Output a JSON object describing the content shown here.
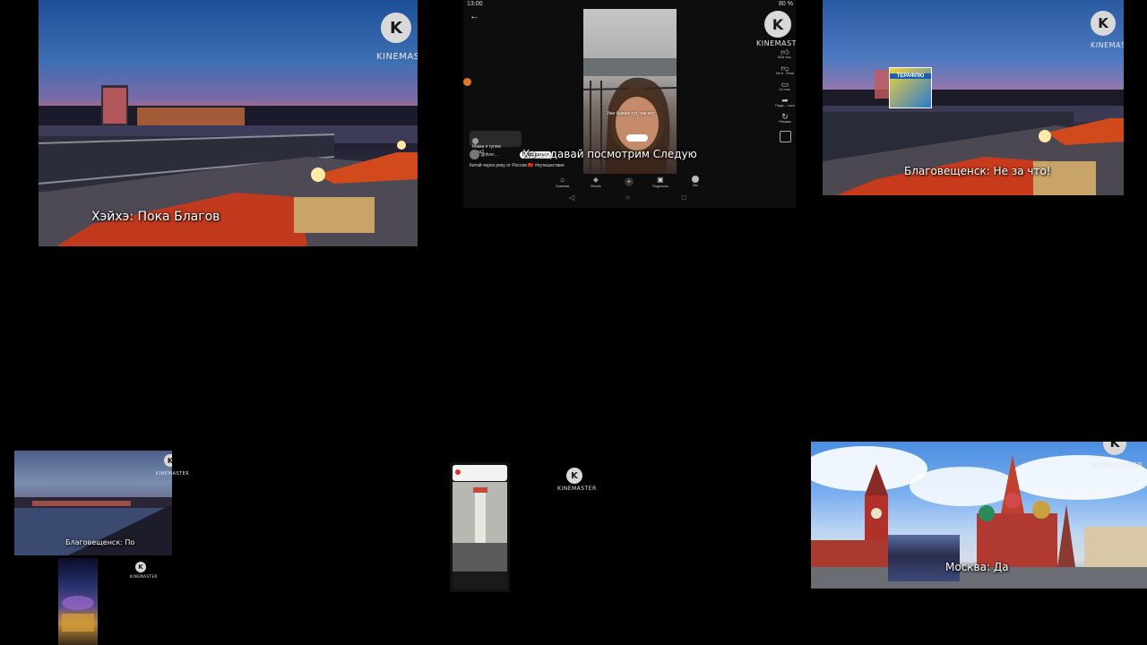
{
  "watermark": {
    "brand": "KINEMASTER",
    "glyph": "K"
  },
  "tiles": {
    "heihe": {
      "caption": "Хэйхэ: Пока Благов"
    },
    "shorts": {
      "status_time": "13:00",
      "status_battery": "80 %",
      "caption": "Хэ…  давай посмотрим Следую",
      "overlay_text": "Уже бываю тут, так вот",
      "comment_bubble": "Мама я гуляю\nкуда?",
      "channel_handle": "@dvor…",
      "subscribe": "Подписаться",
      "description": "Китай через реку от России 🇨🇳 #путешествие",
      "actions": [
        {
          "icon": "like-icon",
          "label": "618 тыс."
        },
        {
          "icon": "dislike-icon",
          "label": "Не н…нтся"
        },
        {
          "icon": "comment-icon",
          "label": "14 тыс."
        },
        {
          "icon": "share-icon",
          "label": "Поде…ться"
        },
        {
          "icon": "remix-icon",
          "label": "Ремикс"
        }
      ],
      "nav": [
        {
          "icon": "home-icon",
          "label": "Главная"
        },
        {
          "icon": "shorts-icon",
          "label": "Shorts"
        },
        {
          "icon": "plus-icon",
          "label": ""
        },
        {
          "icon": "subscriptions-icon",
          "label": "Подписки"
        },
        {
          "icon": "you-icon",
          "label": "Вы"
        }
      ]
    },
    "blago": {
      "caption": "Благовещенск: Не за что!",
      "product_label": "ТЕРАФЛЮ"
    },
    "river": {
      "caption": "Благовещенск: По"
    },
    "moscow": {
      "caption": "Москва: Да"
    }
  },
  "colors": {
    "accent_flowers": "#e0441e",
    "lamp": "#ffe9a8",
    "night_sky": "#1d4f96"
  }
}
